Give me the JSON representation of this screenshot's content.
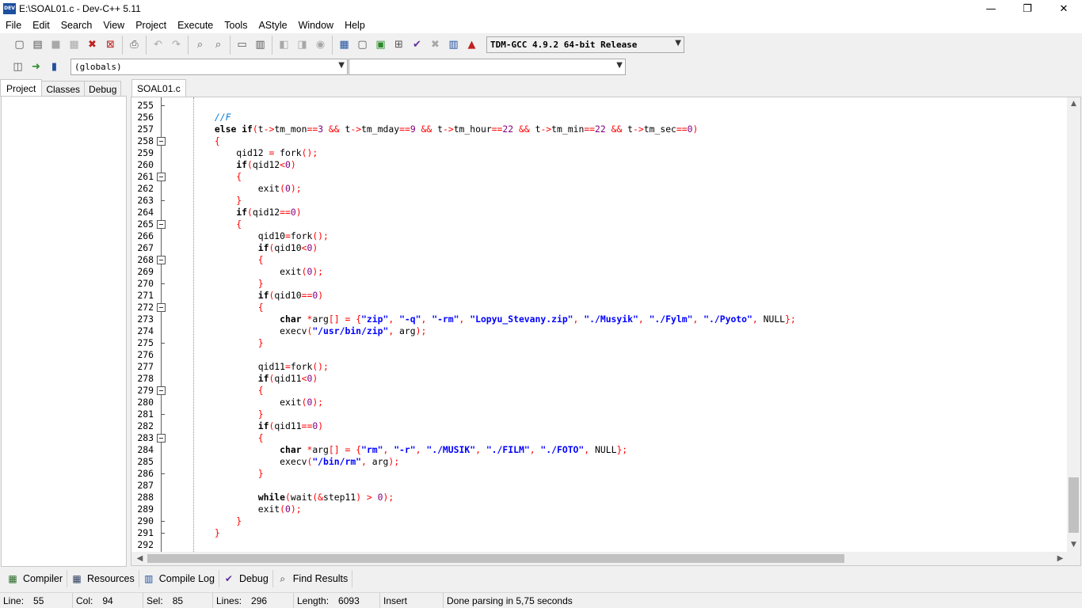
{
  "window": {
    "title": "E:\\SOAL01.c - Dev-C++ 5.11",
    "icon_label": "DEV",
    "controls": [
      "—",
      "❐",
      "✕"
    ]
  },
  "menu": [
    "File",
    "Edit",
    "Search",
    "View",
    "Project",
    "Execute",
    "Tools",
    "AStyle",
    "Window",
    "Help"
  ],
  "toolbar": {
    "compiler": "TDM-GCC 4.9.2 64-bit Release",
    "scope": "(globals)",
    "member": ""
  },
  "left_panel": {
    "tabs": [
      "Project",
      "Classes",
      "Debug"
    ]
  },
  "editor": {
    "tab": "SOAL01.c",
    "lines": [
      {
        "n": "255",
        "fold": "tick",
        "html": ""
      },
      {
        "n": "256",
        "fold": "",
        "html": "        <span class=\"cmt\">//F</span>"
      },
      {
        "n": "257",
        "fold": "",
        "html": "        <span class=\"kw\">else if</span><span class=\"sym\">(</span>t<span class=\"sym\">-&gt;</span>tm_mon<span class=\"sym\">==</span><span class=\"num\">3</span> <span class=\"sym\">&amp;&amp;</span> t<span class=\"sym\">-&gt;</span>tm_mday<span class=\"sym\">==</span><span class=\"num\">9</span> <span class=\"sym\">&amp;&amp;</span> t<span class=\"sym\">-&gt;</span>tm_hour<span class=\"sym\">==</span><span class=\"num\">22</span> <span class=\"sym\">&amp;&amp;</span> t<span class=\"sym\">-&gt;</span>tm_min<span class=\"sym\">==</span><span class=\"num\">22</span> <span class=\"sym\">&amp;&amp;</span> t<span class=\"sym\">-&gt;</span>tm_sec<span class=\"sym\">==</span><span class=\"num\">0</span><span class=\"sym\">)</span>"
      },
      {
        "n": "258",
        "fold": "box",
        "html": "        <span class=\"sym\">{</span>"
      },
      {
        "n": "259",
        "fold": "",
        "html": "            qid12 <span class=\"sym\">=</span> fork<span class=\"sym\">();</span>"
      },
      {
        "n": "260",
        "fold": "",
        "html": "            <span class=\"kw\">if</span><span class=\"sym\">(</span>qid12<span class=\"sym\">&lt;</span><span class=\"num\">0</span><span class=\"sym\">)</span>"
      },
      {
        "n": "261",
        "fold": "box",
        "html": "            <span class=\"sym\">{</span>"
      },
      {
        "n": "262",
        "fold": "",
        "html": "                exit<span class=\"sym\">(</span><span class=\"num\">0</span><span class=\"sym\">);</span>"
      },
      {
        "n": "263",
        "fold": "tick",
        "html": "            <span class=\"sym\">}</span>"
      },
      {
        "n": "264",
        "fold": "",
        "html": "            <span class=\"kw\">if</span><span class=\"sym\">(</span>qid12<span class=\"sym\">==</span><span class=\"num\">0</span><span class=\"sym\">)</span>"
      },
      {
        "n": "265",
        "fold": "box",
        "html": "            <span class=\"sym\">{</span>"
      },
      {
        "n": "266",
        "fold": "",
        "html": "                qid10<span class=\"sym\">=</span>fork<span class=\"sym\">();</span>"
      },
      {
        "n": "267",
        "fold": "",
        "html": "                <span class=\"kw\">if</span><span class=\"sym\">(</span>qid10<span class=\"sym\">&lt;</span><span class=\"num\">0</span><span class=\"sym\">)</span>"
      },
      {
        "n": "268",
        "fold": "box",
        "html": "                <span class=\"sym\">{</span>"
      },
      {
        "n": "269",
        "fold": "",
        "html": "                    exit<span class=\"sym\">(</span><span class=\"num\">0</span><span class=\"sym\">);</span>"
      },
      {
        "n": "270",
        "fold": "tick",
        "html": "                <span class=\"sym\">}</span>"
      },
      {
        "n": "271",
        "fold": "",
        "html": "                <span class=\"kw\">if</span><span class=\"sym\">(</span>qid10<span class=\"sym\">==</span><span class=\"num\">0</span><span class=\"sym\">)</span>"
      },
      {
        "n": "272",
        "fold": "box",
        "html": "                <span class=\"sym\">{</span>"
      },
      {
        "n": "273",
        "fold": "",
        "html": "                    <span class=\"kw\">char</span> <span class=\"sym\">*</span>arg<span class=\"sym\">[]</span> <span class=\"sym\">=</span> <span class=\"sym\">{</span><span class=\"str\">\"zip\"</span><span class=\"sym\">,</span> <span class=\"str\">\"-q\"</span><span class=\"sym\">,</span> <span class=\"str\">\"-rm\"</span><span class=\"sym\">,</span> <span class=\"str\">\"Lopyu_Stevany.zip\"</span><span class=\"sym\">,</span> <span class=\"str\">\"./Musyik\"</span><span class=\"sym\">,</span> <span class=\"str\">\"./Fylm\"</span><span class=\"sym\">,</span> <span class=\"str\">\"./Pyoto\"</span><span class=\"sym\">,</span> NULL<span class=\"sym\">};</span>"
      },
      {
        "n": "274",
        "fold": "",
        "html": "                    execv<span class=\"sym\">(</span><span class=\"str\">\"/usr/bin/zip\"</span><span class=\"sym\">,</span> arg<span class=\"sym\">);</span>"
      },
      {
        "n": "275",
        "fold": "tick",
        "html": "                <span class=\"sym\">}</span>"
      },
      {
        "n": "276",
        "fold": "",
        "html": ""
      },
      {
        "n": "277",
        "fold": "",
        "html": "                qid11<span class=\"sym\">=</span>fork<span class=\"sym\">();</span>"
      },
      {
        "n": "278",
        "fold": "",
        "html": "                <span class=\"kw\">if</span><span class=\"sym\">(</span>qid11<span class=\"sym\">&lt;</span><span class=\"num\">0</span><span class=\"sym\">)</span>"
      },
      {
        "n": "279",
        "fold": "box",
        "html": "                <span class=\"sym\">{</span>"
      },
      {
        "n": "280",
        "fold": "",
        "html": "                    exit<span class=\"sym\">(</span><span class=\"num\">0</span><span class=\"sym\">);</span>"
      },
      {
        "n": "281",
        "fold": "tick",
        "html": "                <span class=\"sym\">}</span>"
      },
      {
        "n": "282",
        "fold": "",
        "html": "                <span class=\"kw\">if</span><span class=\"sym\">(</span>qid11<span class=\"sym\">==</span><span class=\"num\">0</span><span class=\"sym\">)</span>"
      },
      {
        "n": "283",
        "fold": "box",
        "html": "                <span class=\"sym\">{</span>"
      },
      {
        "n": "284",
        "fold": "",
        "html": "                    <span class=\"kw\">char</span> <span class=\"sym\">*</span>arg<span class=\"sym\">[]</span> <span class=\"sym\">=</span> <span class=\"sym\">{</span><span class=\"str\">\"rm\"</span><span class=\"sym\">,</span> <span class=\"str\">\"-r\"</span><span class=\"sym\">,</span> <span class=\"str\">\"./MUSIK\"</span><span class=\"sym\">,</span> <span class=\"str\">\"./FILM\"</span><span class=\"sym\">,</span> <span class=\"str\">\"./FOTO\"</span><span class=\"sym\">,</span> NULL<span class=\"sym\">};</span>"
      },
      {
        "n": "285",
        "fold": "",
        "html": "                    execv<span class=\"sym\">(</span><span class=\"str\">\"/bin/rm\"</span><span class=\"sym\">,</span> arg<span class=\"sym\">);</span>"
      },
      {
        "n": "286",
        "fold": "tick",
        "html": "                <span class=\"sym\">}</span>"
      },
      {
        "n": "287",
        "fold": "",
        "html": ""
      },
      {
        "n": "288",
        "fold": "",
        "html": "                <span class=\"kw\">while</span><span class=\"sym\">(</span>wait<span class=\"sym\">(&amp;</span>step11<span class=\"sym\">)</span> <span class=\"sym\">&gt;</span> <span class=\"num\">0</span><span class=\"sym\">);</span>"
      },
      {
        "n": "289",
        "fold": "",
        "html": "                exit<span class=\"sym\">(</span><span class=\"num\">0</span><span class=\"sym\">);</span>"
      },
      {
        "n": "290",
        "fold": "tick",
        "html": "            <span class=\"sym\">}</span>"
      },
      {
        "n": "291",
        "fold": "tick",
        "html": "        <span class=\"sym\">}</span>"
      },
      {
        "n": "292",
        "fold": "",
        "html": ""
      }
    ]
  },
  "bottom_tabs": [
    {
      "label": "Compiler",
      "icon": "compiler-icon"
    },
    {
      "label": "Resources",
      "icon": "resources-icon"
    },
    {
      "label": "Compile Log",
      "icon": "compile-log-icon"
    },
    {
      "label": "Debug",
      "icon": "debug-icon"
    },
    {
      "label": "Find Results",
      "icon": "find-results-icon"
    }
  ],
  "status": {
    "line_label": "Line:",
    "line": "55",
    "col_label": "Col:",
    "col": "94",
    "sel_label": "Sel:",
    "sel": "85",
    "lines_label": "Lines:",
    "lines": "296",
    "length_label": "Length:",
    "length": "6093",
    "mode": "Insert",
    "message": "Done parsing in 5,75 seconds"
  }
}
